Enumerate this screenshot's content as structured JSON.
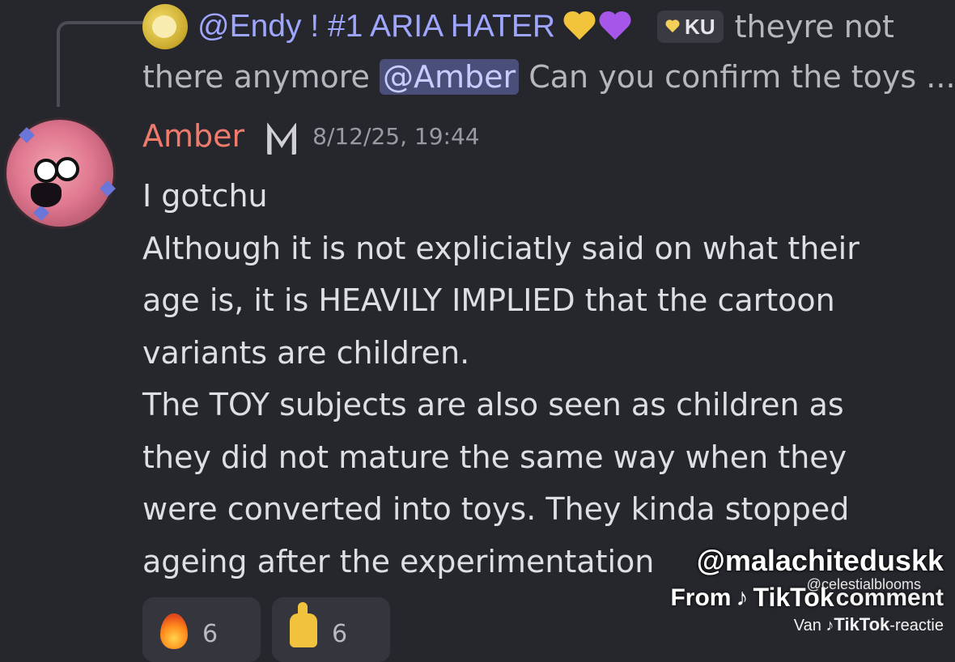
{
  "reply": {
    "author": "@Endy ! #1 ARIA HATER",
    "tag": "KU",
    "line1_text": "theyre not",
    "line2_before": "there anymore",
    "mention": "@Amber",
    "line2_after": "Can you confirm the toys ..."
  },
  "message": {
    "author": "Amber",
    "timestamp": "8/12/25, 19:44",
    "lines": [
      "I gotchu",
      "Although it is not expliciatly said on what their",
      "age is, it is HEAVILY IMPLIED that the cartoon",
      "variants are children.",
      "The TOY subjects are also seen as children as",
      "they did not mature the same way when they",
      "were converted into toys. They kinda stopped",
      "ageing after the experimentation"
    ]
  },
  "reactions": [
    {
      "icon": "fire-icon",
      "count": "6"
    },
    {
      "icon": "thumbs-up-icon",
      "count": "6"
    }
  ],
  "watermark": {
    "handle": "@malachiteduskk",
    "from": "From",
    "tiktok": "TikTok",
    "comment": "comment",
    "small_handle": "@celestialblooms",
    "van": "Van",
    "reactie": "-reactie"
  }
}
